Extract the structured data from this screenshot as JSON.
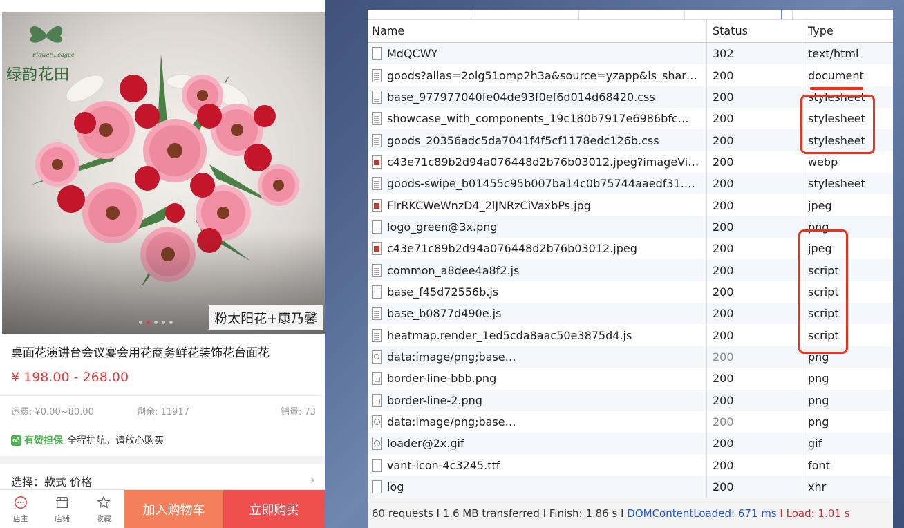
{
  "shop": {
    "brand": {
      "name_cn": "绿韵花田",
      "name_en": "Flower League"
    },
    "hero_caption": "粉太阳花+康乃馨",
    "product_title": "桌面花演讲台会议宴会用花商务鲜花装饰花台面花",
    "price": "¥ 198.00 - 268.00",
    "meta": {
      "shipping": "运费: ¥0.00~80.00",
      "stock": "剩余: 11917",
      "sales": "销量: 73"
    },
    "guarantee": {
      "badge": "有赞担保",
      "text": "全程护航，请放心购买"
    },
    "choose": "选择：款式  价格",
    "bottom_bar": {
      "tabs": [
        {
          "label": "店主",
          "icon": "chat-icon"
        },
        {
          "label": "店铺",
          "icon": "shop-icon"
        },
        {
          "label": "收藏",
          "icon": "star-icon"
        }
      ],
      "add_to_cart": "加入购物车",
      "buy_now": "立即购买"
    }
  },
  "network": {
    "columns": {
      "name": "Name",
      "status": "Status",
      "type": "Type"
    },
    "rows": [
      {
        "name": "MdQCWY",
        "status": "302",
        "type": "text/html",
        "icon": "blank"
      },
      {
        "name": "goods?alias=2olg51omp2h3a&source=yzapp&is_shar…",
        "status": "200",
        "type": "document",
        "icon": "doc"
      },
      {
        "name": "base_977977040fe04de93f0ef6d014d68420.css",
        "status": "200",
        "type": "stylesheet",
        "icon": "doc"
      },
      {
        "name": "showcase_with_components_19c180b7917e6986bfc…",
        "status": "200",
        "type": "stylesheet",
        "icon": "doc"
      },
      {
        "name": "goods_20356adc5da7041f4f5cf1178edc126b.css",
        "status": "200",
        "type": "stylesheet",
        "icon": "doc"
      },
      {
        "name": "c43e71c89b2d94a076448d2b76b03012.jpeg?imageVi…",
        "status": "200",
        "type": "webp",
        "icon": "img"
      },
      {
        "name": "goods-swipe_b01455c95b007ba14c0b75744aaedf31.…",
        "status": "200",
        "type": "stylesheet",
        "icon": "doc"
      },
      {
        "name": "FlrRKCWeWnzD4_2lJNRzCiVaxbPs.jpg",
        "status": "200",
        "type": "jpeg",
        "icon": "img"
      },
      {
        "name": "logo_green@3x.png",
        "status": "200",
        "type": "png",
        "icon": "line"
      },
      {
        "name": "c43e71c89b2d94a076448d2b76b03012.jpeg",
        "status": "200",
        "type": "jpeg",
        "icon": "img"
      },
      {
        "name": "common_a8dee4a8f2.js",
        "status": "200",
        "type": "script",
        "icon": "doc"
      },
      {
        "name": "base_f45d72556b.js",
        "status": "200",
        "type": "script",
        "icon": "doc"
      },
      {
        "name": "base_b0877d490e.js",
        "status": "200",
        "type": "script",
        "icon": "doc"
      },
      {
        "name": "heatmap.render_1ed5cda8aac50e3875d4.js",
        "status": "200",
        "type": "script",
        "icon": "doc"
      },
      {
        "name": "data:image/png;base…",
        "status": "200",
        "type": "png",
        "icon": "search",
        "muted": true
      },
      {
        "name": "border-line-bbb.png",
        "status": "200",
        "type": "png",
        "icon": "sq"
      },
      {
        "name": "border-line-2.png",
        "status": "200",
        "type": "png",
        "icon": "sq"
      },
      {
        "name": "data:image/png;base…",
        "status": "200",
        "type": "png",
        "icon": "circ",
        "muted": true
      },
      {
        "name": "loader@2x.gif",
        "status": "200",
        "type": "gif",
        "icon": "circ"
      },
      {
        "name": "vant-icon-4c3245.ttf",
        "status": "200",
        "type": "font",
        "icon": "blank"
      },
      {
        "name": "log",
        "status": "200",
        "type": "xhr",
        "icon": "blank"
      }
    ],
    "footer": {
      "summary": "60 requests I 1.6 MB transferred I Finish: 1.86 s I",
      "dom_loaded": "DOMContentLoaded: 671 ms",
      "sep": "I",
      "load": "Load: 1.01 s"
    }
  }
}
